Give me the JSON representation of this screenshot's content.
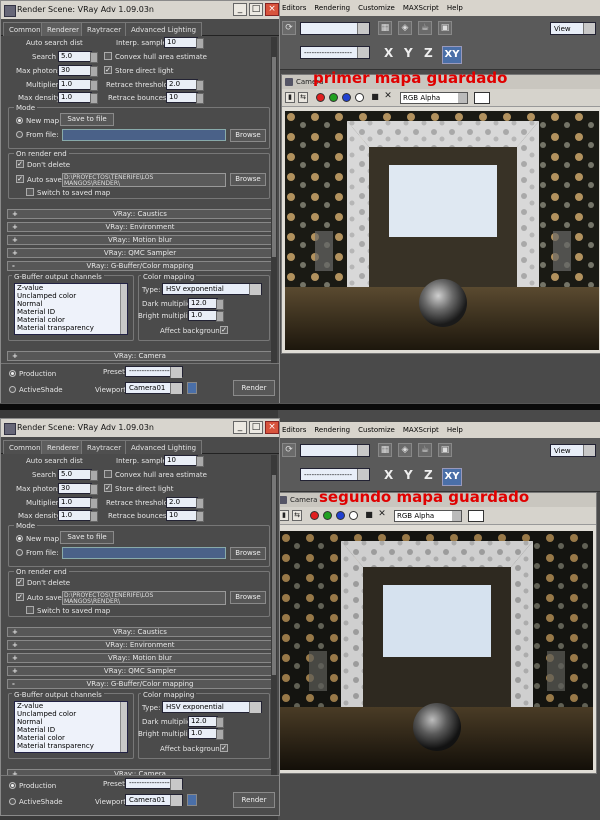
{
  "dialog": {
    "title": "Render Scene: VRay Adv 1.09.03n",
    "min_glyph": "_",
    "max_glyph": "□",
    "close_glyph": "×",
    "tabs": [
      "Common",
      "Renderer",
      "Raytracer",
      "Advanced Lighting"
    ],
    "photon": {
      "auto_search_dist": "Auto search dist",
      "interp_samples_label": "Interp. samples:",
      "interp_samples": "10",
      "search_dist_label": "Search dist:",
      "search_dist": "5.0",
      "convex_hull": "Convex hull area estimate",
      "max_photons_label": "Max photons:",
      "max_photons": "30",
      "store_direct": "Store direct light",
      "multiplier_label": "Multiplier:",
      "multiplier": "1.0",
      "retrace_threshold_label": "Retrace threshold:",
      "retrace_threshold": "2.0",
      "max_density_label": "Max density:",
      "max_density": "1.0",
      "retrace_bounces_label": "Retrace bounces:",
      "retrace_bounces": "10"
    },
    "mode": {
      "title": "Mode",
      "new_map": "New map",
      "save_to_file": "Save to file",
      "from_file": "From file:",
      "browse": "Browse"
    },
    "on_render_end": {
      "title": "On render end",
      "dont_delete": "Don't delete",
      "auto_save": "Auto save:",
      "auto_save_path_1": "D:\\PROYECTOS\\TENERIFE\\LOS",
      "auto_save_path_2": "MANGOS\\RENDER\\",
      "browse": "Browse",
      "switch_saved": "Switch to saved map"
    },
    "rollouts": [
      {
        "sign": "+",
        "label": "VRay:: Caustics"
      },
      {
        "sign": "+",
        "label": "VRay:: Environment"
      },
      {
        "sign": "+",
        "label": "VRay:: Motion blur"
      },
      {
        "sign": "+",
        "label": "VRay:: QMC Sampler"
      },
      {
        "sign": "-",
        "label": "VRay:: G-Buffer/Color mapping"
      }
    ],
    "gbuffer": {
      "title": "G-Buffer output channels",
      "channels": [
        "Z-value",
        "Unclamped color",
        "Normal",
        "Material ID",
        "Material color",
        "Material transparency"
      ]
    },
    "color_mapping": {
      "title": "Color mapping",
      "type_label": "Type:",
      "type": "HSV exponential",
      "dark_label": "Dark multiplier:",
      "dark": "12.0",
      "bright_label": "Bright multiplier:",
      "bright": "1.0",
      "affect_bg": "Affect background"
    },
    "camera_rollout": {
      "sign": "+",
      "label": "VRay:: Camera"
    },
    "bottom": {
      "production": "Production",
      "activeshade": "ActiveShade",
      "preset_label": "Preset:",
      "preset": "-------------------",
      "viewport_label": "Viewport:",
      "viewport": "Camera01",
      "render": "Render"
    }
  },
  "max": {
    "menu": [
      "Editors",
      "Rendering",
      "Customize",
      "MAXScript",
      "Help"
    ],
    "view_dropdown": "View",
    "axes": [
      "X",
      "Y",
      "Z"
    ],
    "xy": "XY",
    "selection_dropdown": "-------------------"
  },
  "framebuffer": {
    "title": "Camera",
    "channel": "RGB Alpha"
  },
  "captions": {
    "first": "primer mapa guardado",
    "second": "segundo mapa guardado"
  },
  "colors": {
    "caption": "#e00000",
    "xy_active": "#4a6fa8",
    "dot_red": "#e02020",
    "dot_green": "#20a020",
    "dot_blue": "#2040d0"
  }
}
